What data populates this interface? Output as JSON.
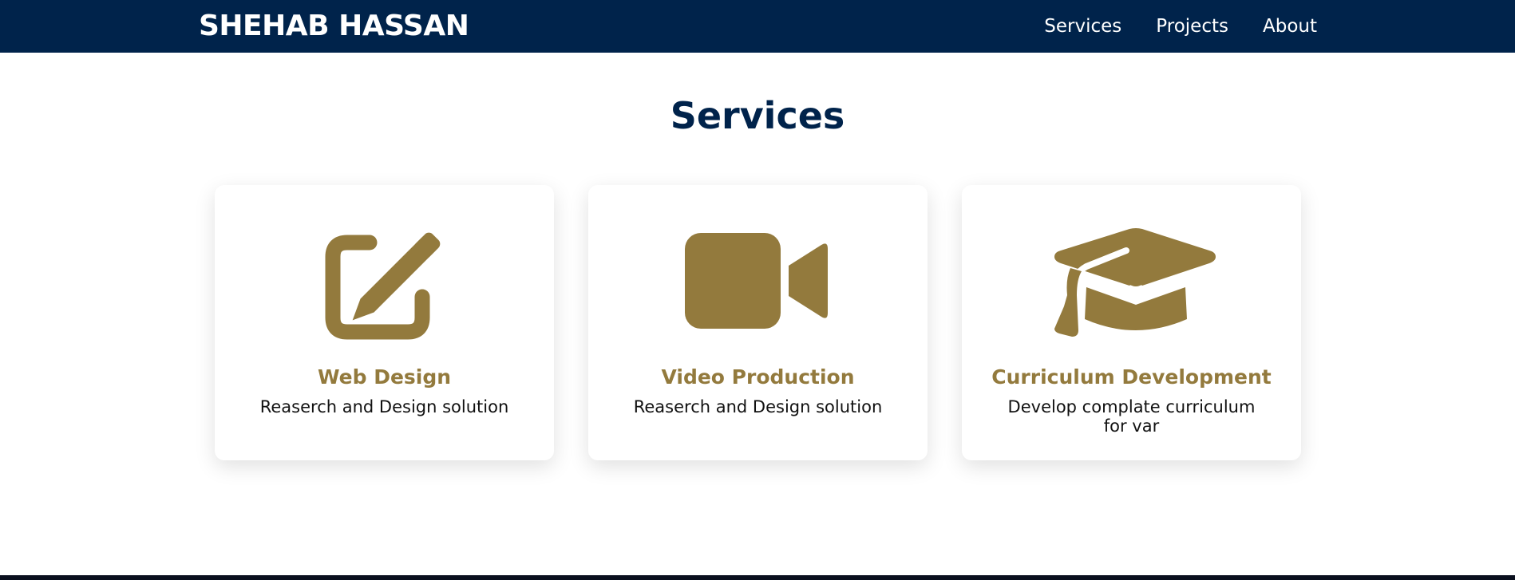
{
  "header": {
    "brand": "SHEHAB HASSAN",
    "nav": [
      "Services",
      "Projects",
      "About"
    ]
  },
  "services_section": {
    "title": "Services",
    "cards": [
      {
        "icon": "edit-icon",
        "title": "Web Design",
        "description": "Reaserch and Design solution"
      },
      {
        "icon": "video-camera-icon",
        "title": "Video Production",
        "description": "Reaserch and Design solution"
      },
      {
        "icon": "graduation-cap-icon",
        "title": "Curriculum Development",
        "description": "Develop complate curriculum for var"
      }
    ]
  },
  "colors": {
    "navbar_bg": "#00234b",
    "accent_gold": "#937a3d",
    "title_navy": "#00234b"
  }
}
